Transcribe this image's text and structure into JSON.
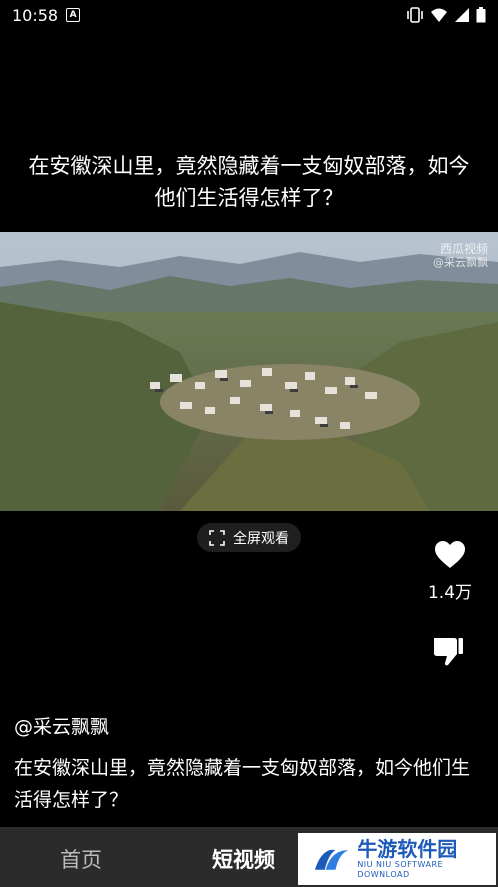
{
  "status_bar": {
    "time": "10:58",
    "notification_letter": "A"
  },
  "video": {
    "title": "在安徽深山里，竟然隐藏着一支匈奴部落，如今他们生活得怎样了？",
    "watermark_main": "西瓜视频",
    "watermark_sub": "@采云飘飘",
    "fullscreen_label": "全屏观看"
  },
  "actions": {
    "like_count": "1.4万",
    "accent_color": "#ffffff"
  },
  "post": {
    "author": "@采云飘飘",
    "description": "在安徽深山里，竟然隐藏着一支匈奴部落，如今他们生活得怎样了？"
  },
  "bottom_nav": {
    "home_label": "首页",
    "short_video_label": "短视频"
  },
  "ad": {
    "brand": "牛游软件园",
    "brand_sub": "NIU NIU SOFTWARE DOWNLOAD",
    "brand_color": "#1d5bb8"
  }
}
